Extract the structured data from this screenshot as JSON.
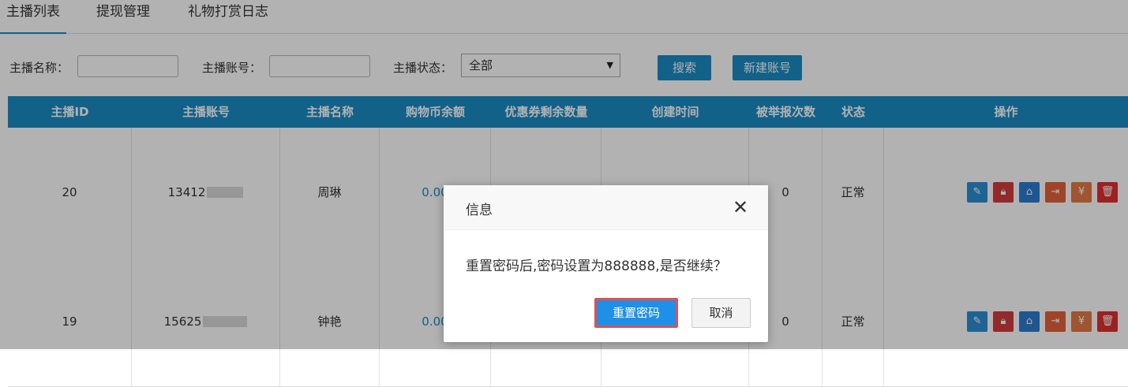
{
  "tabs": [
    {
      "label": "主播列表",
      "active": true
    },
    {
      "label": "提现管理",
      "active": false
    },
    {
      "label": "礼物打赏日志",
      "active": false
    }
  ],
  "filters": {
    "name_label": "主播名称：",
    "name_value": "",
    "account_label": "主播账号：",
    "account_value": "",
    "status_label": "主播状态：",
    "status_value": "全部",
    "search_button": "搜索",
    "new_account_button": "新建账号"
  },
  "table": {
    "columns": [
      "主播ID",
      "主播账号",
      "主播名称",
      "购物币余额",
      "优惠券剩余数量",
      "创建时间",
      "被举报次数",
      "状态",
      "操作"
    ],
    "rows": [
      {
        "id": "20",
        "account": "13412",
        "name": "周琳",
        "balance": "0.00",
        "coupons": "",
        "created": "",
        "reports": "0",
        "status": "正常"
      },
      {
        "id": "19",
        "account": "15625",
        "name": "钟艳",
        "balance": "0.00",
        "coupons": "",
        "created": "",
        "reports": "0",
        "status": "正常"
      }
    ]
  },
  "dialog": {
    "title": "信息",
    "message": "重置密码后,密码设置为888888,是否继续？",
    "confirm": "重置密码",
    "cancel": "取消"
  },
  "icons": {
    "row_actions": [
      "edit-icon",
      "lock-icon",
      "home-icon",
      "export-icon",
      "money-icon",
      "delete-icon"
    ],
    "close": "close-icon",
    "dropdown": "chevron-down-icon"
  },
  "colors": {
    "primary": "#1a8bc4",
    "confirm_button": "#1e90e8",
    "confirm_border": "#e0504f",
    "danger": "#e03030"
  }
}
